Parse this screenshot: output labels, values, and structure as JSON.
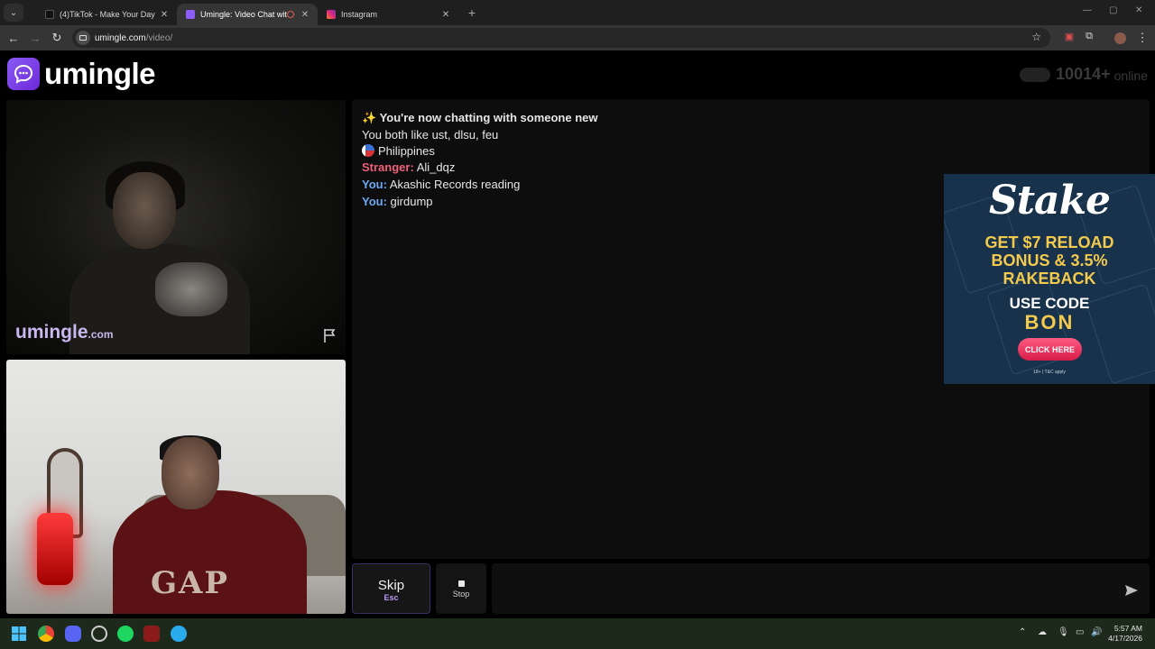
{
  "browser": {
    "tabs": [
      {
        "label": "(4)TikTok - Make Your Day",
        "active": false,
        "favicon_color": "#1a1a1a"
      },
      {
        "label": "Umingle: Video Chat with S",
        "active": true,
        "favicon_color": "#8b5cf6"
      },
      {
        "label": "Instagram",
        "active": false,
        "favicon_color": "#d62976"
      }
    ],
    "url_host": "umingle.com",
    "url_path": "/video/"
  },
  "site": {
    "logo_text": "umingle",
    "online_count": "10014+",
    "online_label": "online"
  },
  "stranger_video": {
    "watermark_main": "umingle",
    "watermark_suffix": ".com"
  },
  "you_video": {
    "shirt_text": "GAP"
  },
  "chat": {
    "intro": "✨ You're now chatting with someone new",
    "interests": "You both like ust, dlsu, feu",
    "country": "Philippines",
    "messages": [
      {
        "who": "Stranger:",
        "text": "Ali_dqz"
      },
      {
        "who": "You:",
        "text": "Akashic Records reading"
      },
      {
        "who": "You:",
        "text": "girdump"
      }
    ]
  },
  "ad": {
    "brand": "Stake",
    "line1": "GET $7 RELOAD",
    "line2": "BONUS & 3.5%",
    "line3": "RAKEBACK",
    "line4": "USE CODE",
    "code": "BON",
    "button": "CLICK HERE",
    "terms": "18+ | T&C apply"
  },
  "controls": {
    "skip_label": "Skip",
    "skip_hint": "Esc",
    "stop_label": "Stop",
    "input_value": ""
  },
  "taskbar": {
    "time": "5:57 AM",
    "date": "4/17/2026"
  }
}
